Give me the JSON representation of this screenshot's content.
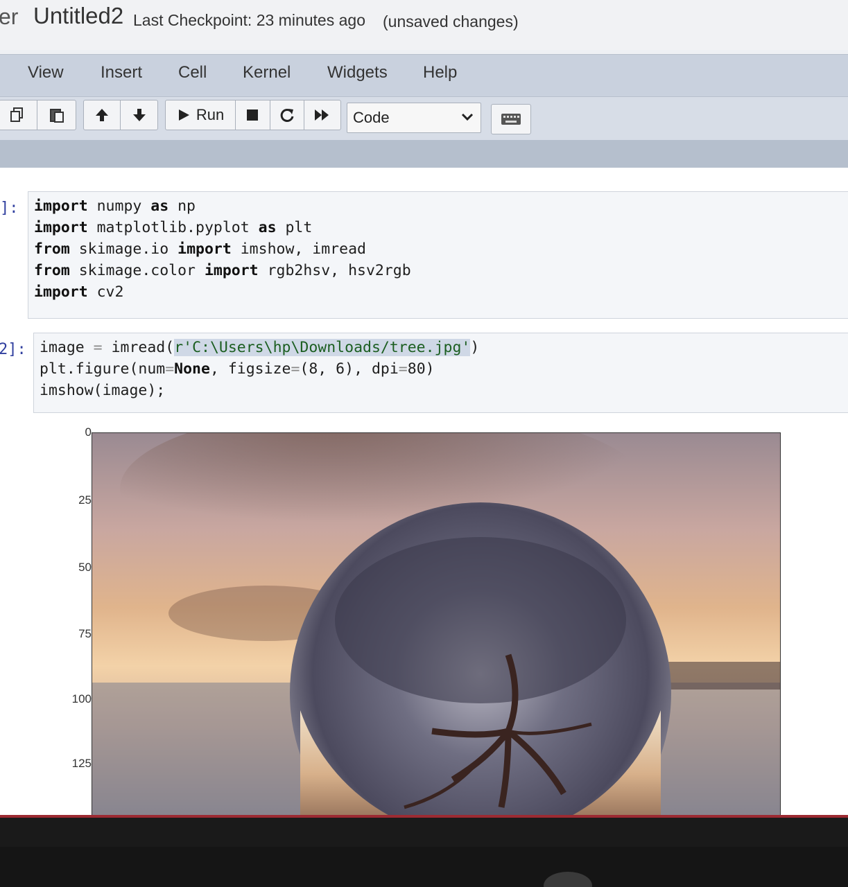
{
  "header": {
    "logo_fragment": "er",
    "notebook_title": "Untitled2",
    "checkpoint": "Last Checkpoint: 23 minutes ago",
    "unsaved": "(unsaved changes)"
  },
  "menu": [
    "View",
    "Insert",
    "Cell",
    "Kernel",
    "Widgets",
    "Help"
  ],
  "toolbar": {
    "run_label": "Run",
    "cell_type": "Code",
    "icons": [
      "copy-icon",
      "paste-icon",
      "move-up-icon",
      "move-down-icon",
      "run-icon",
      "stop-icon",
      "restart-icon",
      "fast-forward-icon",
      "keyboard-icon"
    ]
  },
  "cells": [
    {
      "prompt": "]:",
      "lines": [
        "import numpy as np",
        "import matplotlib.pyplot as plt",
        "from skimage.io import imshow, imread",
        "from skimage.color import rgb2hsv, hsv2rgb",
        "import cv2"
      ]
    },
    {
      "prompt": "2]:",
      "lines": [
        "image = imread(r'C:\\Users\\hp\\Downloads/tree.jpg')",
        "plt.figure(num=None, figsize=(8, 6), dpi=80)",
        "imshow(image);"
      ]
    }
  ],
  "figure": {
    "yticks": [
      "0",
      "25",
      "50",
      "75",
      "100",
      "125"
    ]
  },
  "taskbar": {
    "icons": [
      "file-explorer-icon",
      "settings-icon",
      "mail-icon",
      "chrome-icon",
      "loading-icon"
    ]
  },
  "colors": {
    "taskbar": "#9c2a32",
    "menubar": "#c9d1de",
    "prompt": "#303f9f"
  }
}
